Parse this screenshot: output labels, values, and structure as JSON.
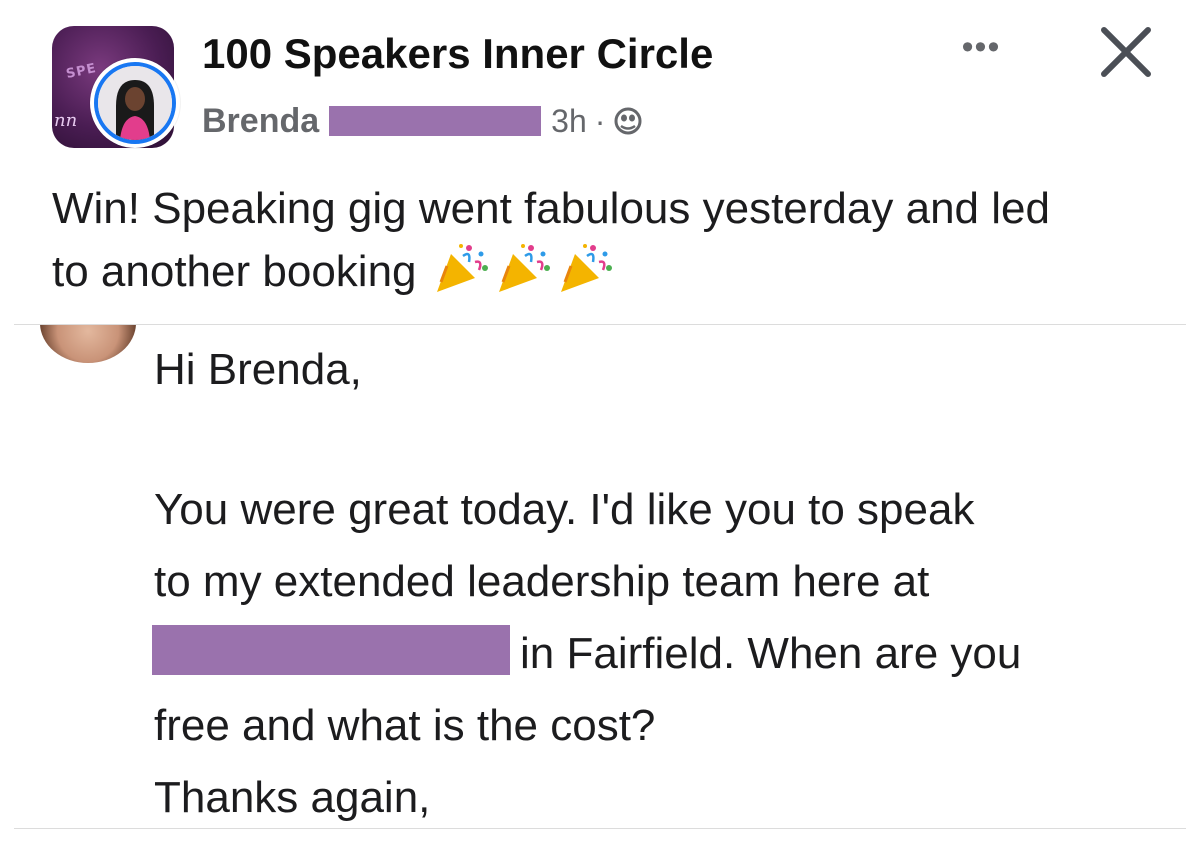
{
  "post": {
    "group_name": "100 Speakers Inner Circle",
    "author_first_name": "Brenda",
    "time_ago": "3h",
    "separator": "·",
    "privacy_icon": "globe-icon",
    "more_label": "•••",
    "close_icon": "close-icon",
    "group_avatar_text": "SPE",
    "group_avatar_script": "nn",
    "text_line1": "Win! Speaking gig went fabulous yesterday and led",
    "text_line2": "to another booking",
    "emojis": [
      "party-popper-icon",
      "party-popper-icon",
      "party-popper-icon"
    ]
  },
  "email": {
    "greeting": "Hi Brenda,",
    "line1": "You were great today. I'd like you to speak",
    "line2": "to my extended leadership team here at",
    "line3": "in Fairfield.  When are you",
    "line4": "free and what is the cost?",
    "line5": "Thanks again,"
  },
  "colors": {
    "redaction": "#9a72ad",
    "avatar_ring": "#1877f2",
    "meta_gray": "#65676b"
  }
}
